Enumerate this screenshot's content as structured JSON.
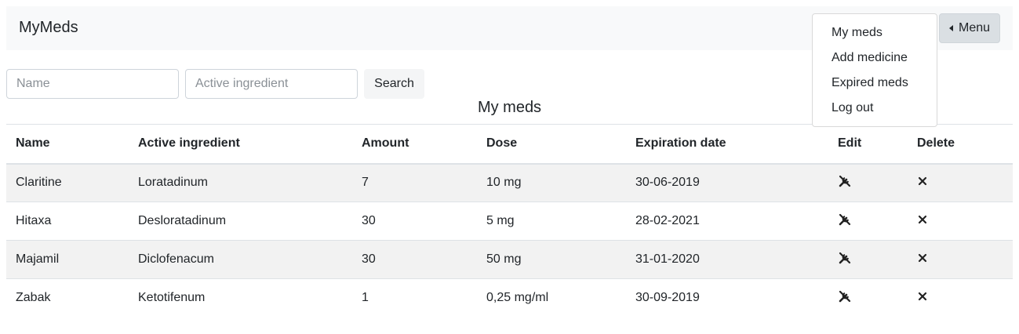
{
  "app": {
    "brand": "MyMeds"
  },
  "menu": {
    "label": "Menu",
    "items": [
      "My meds",
      "Add medicine",
      "Expired meds",
      "Log out"
    ]
  },
  "search": {
    "name_placeholder": "Name",
    "ingredient_placeholder": "Active ingredient",
    "button_label": "Search"
  },
  "table": {
    "caption": "My meds",
    "headers": [
      "Name",
      "Active ingredient",
      "Amount",
      "Dose",
      "Expiration date",
      "Edit",
      "Delete"
    ],
    "rows": [
      [
        "Claritine",
        "Loratadinum",
        "7",
        "10 mg",
        "30-06-2019"
      ],
      [
        "Hitaxa",
        "Desloratadinum",
        "30",
        "5 mg",
        "28-02-2021"
      ],
      [
        "Majamil",
        "Diclofenacum",
        "30",
        "50 mg",
        "31-01-2020"
      ],
      [
        "Zabak",
        "Ketotifenum",
        "1",
        "0,25 mg/ml",
        "30-09-2019"
      ]
    ],
    "edit_icon": "wrench-screwdriver-icon",
    "delete_icon": "close-x-icon"
  }
}
